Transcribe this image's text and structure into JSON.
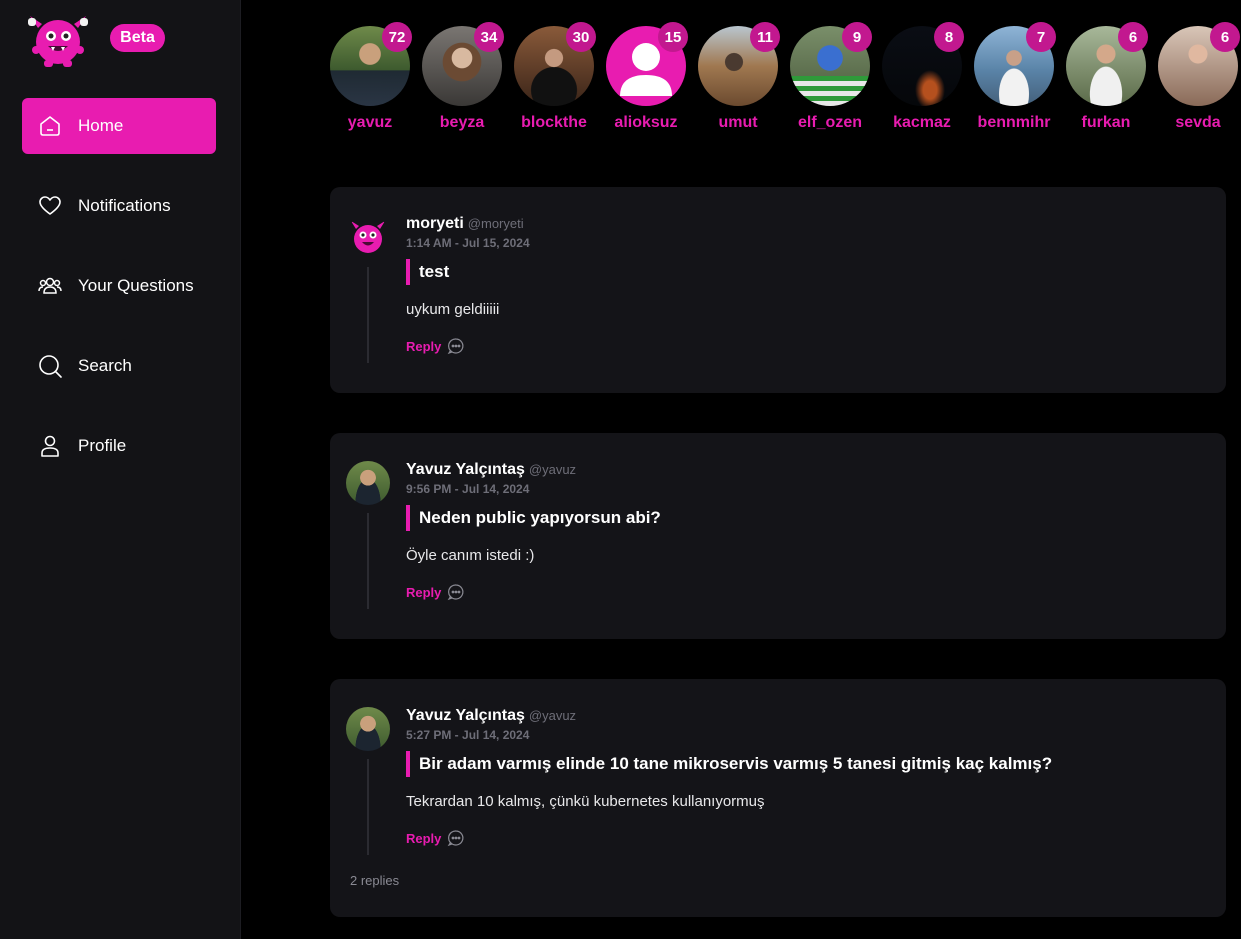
{
  "sidebar": {
    "beta_label": "Beta",
    "nav": [
      {
        "label": "Home",
        "icon": "home-icon",
        "active": true
      },
      {
        "label": "Notifications",
        "icon": "heart-icon"
      },
      {
        "label": "Your Questions",
        "icon": "users-icon"
      },
      {
        "label": "Search",
        "icon": "search-icon"
      },
      {
        "label": "Profile",
        "icon": "user-icon"
      }
    ]
  },
  "stories": [
    {
      "name": "yavuz",
      "count": "72"
    },
    {
      "name": "beyza",
      "count": "34"
    },
    {
      "name": "blockthe",
      "count": "30"
    },
    {
      "name": "alioksuz",
      "count": "15"
    },
    {
      "name": "umut",
      "count": "11"
    },
    {
      "name": "elf_ozen",
      "count": "9"
    },
    {
      "name": "kacmaz",
      "count": "8"
    },
    {
      "name": "bennmihr",
      "count": "7"
    },
    {
      "name": "furkan",
      "count": "6"
    },
    {
      "name": "sevda",
      "count": "6"
    }
  ],
  "posts": [
    {
      "author": "moryeti",
      "handle": "@moryeti",
      "time": "1:14 AM - Jul 15, 2024",
      "question": "test",
      "answer": "uykum geldiiiii",
      "reply_label": "Reply"
    },
    {
      "author": "Yavuz Yalçıntaş",
      "handle": "@yavuz",
      "time": "9:56 PM - Jul 14, 2024",
      "question": "Neden public yapıyorsun abi?",
      "answer": "Öyle canım istedi :)",
      "reply_label": "Reply"
    },
    {
      "author": "Yavuz Yalçıntaş",
      "handle": "@yavuz",
      "time": "5:27 PM - Jul 14, 2024",
      "question": "Bir adam varmış elinde 10 tane mikroservis varmış 5 tanesi gitmiş kaç kalmış?",
      "answer": "Tekrardan 10 kalmış, çünkü kubernetes kullanıyormuş",
      "reply_label": "Reply",
      "replies_count": "2 replies"
    }
  ],
  "colors": {
    "accent": "#e81cb0",
    "background": "#000000",
    "card": "#141418",
    "sidebar": "#131316"
  }
}
